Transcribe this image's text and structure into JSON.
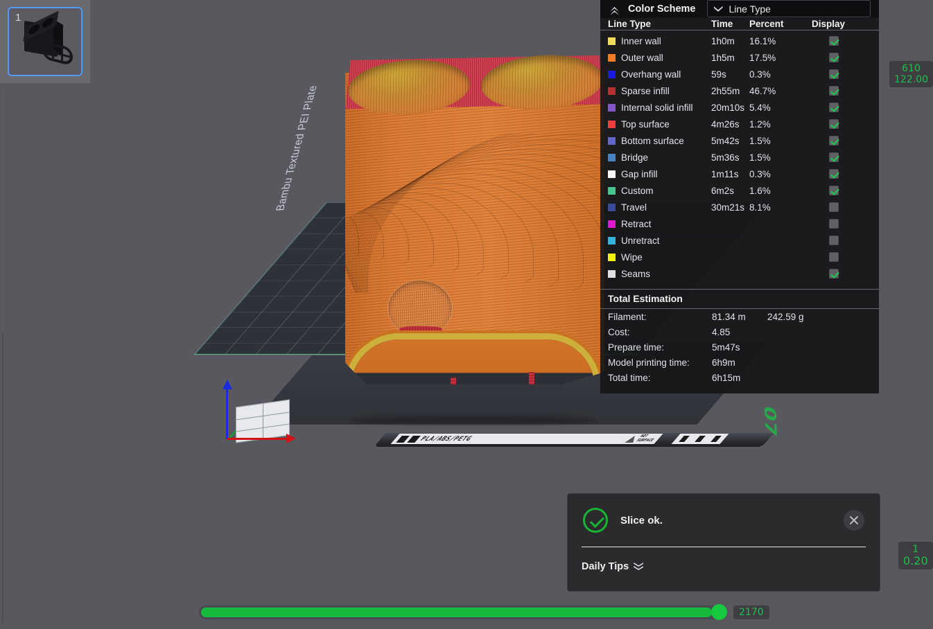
{
  "app": {
    "thumbnail": {
      "plate_number": "1",
      "icon": "plate-thumbnail-icon"
    }
  },
  "viewport": {
    "plate_name": "Bambu Textured PEI Plate",
    "plate_number_marking": "07",
    "bed_material_label": "PLA/ABS/PETG",
    "bed_warning_line1": "HOT",
    "bed_warning_line2": "SURFACE",
    "axis_gizmo": "axis-gizmo"
  },
  "legend": {
    "title": "Color Scheme",
    "collapse_icon": "chevron-up-icon",
    "scheme_select": {
      "value": "Line Type",
      "icon": "chevron-down-icon"
    },
    "columns": {
      "name": "Line Type",
      "time": "Time",
      "percent": "Percent",
      "display": "Display"
    },
    "rows": [
      {
        "color": "#f2dc5a",
        "name": "Inner wall",
        "time": "1h0m",
        "percent": "16.1%",
        "display": true
      },
      {
        "color": "#f07c28",
        "name": "Outer wall",
        "time": "1h5m",
        "percent": "17.5%",
        "display": true
      },
      {
        "color": "#1a1ae8",
        "name": "Overhang wall",
        "time": "59s",
        "percent": "0.3%",
        "display": true
      },
      {
        "color": "#b4332f",
        "name": "Sparse infill",
        "time": "2h55m",
        "percent": "46.7%",
        "display": true
      },
      {
        "color": "#8457c9",
        "name": "Internal solid infill",
        "time": "20m10s",
        "percent": "5.4%",
        "display": true
      },
      {
        "color": "#ef3e3e",
        "name": "Top surface",
        "time": "4m26s",
        "percent": "1.2%",
        "display": true
      },
      {
        "color": "#6267c9",
        "name": "Bottom surface",
        "time": "5m42s",
        "percent": "1.5%",
        "display": true
      },
      {
        "color": "#4783c2",
        "name": "Bridge",
        "time": "5m36s",
        "percent": "1.5%",
        "display": true
      },
      {
        "color": "#f6f6f6",
        "name": "Gap infill",
        "time": "1m11s",
        "percent": "0.3%",
        "display": true
      },
      {
        "color": "#46c68c",
        "name": "Custom",
        "time": "6m2s",
        "percent": "1.6%",
        "display": true
      },
      {
        "color": "#3c4a9e",
        "name": "Travel",
        "time": "30m21s",
        "percent": "8.1%",
        "display": false
      },
      {
        "color": "#e018cf",
        "name": "Retract",
        "time": "",
        "percent": "",
        "display": false
      },
      {
        "color": "#34b3dc",
        "name": "Unretract",
        "time": "",
        "percent": "",
        "display": false
      },
      {
        "color": "#f2f20a",
        "name": "Wipe",
        "time": "",
        "percent": "",
        "display": false
      },
      {
        "color": "#e0e0e0",
        "name": "Seams",
        "time": "",
        "percent": "",
        "display": true
      }
    ],
    "totals": {
      "title": "Total Estimation",
      "rows": [
        {
          "label": "Filament:",
          "value": "81.34 m",
          "value2": "242.59 g"
        },
        {
          "label": "Cost:",
          "value": "4.85",
          "value2": ""
        },
        {
          "label": "Prepare time:",
          "value": "5m47s",
          "value2": ""
        },
        {
          "label": "Model printing time:",
          "value": "6h9m",
          "value2": ""
        },
        {
          "label": "Total time:",
          "value": "6h15m",
          "value2": ""
        }
      ]
    }
  },
  "notification": {
    "status_icon": "check-circle-icon",
    "message": "Slice ok.",
    "close_icon": "close-icon",
    "tips_label": "Daily Tips",
    "tips_icon": "chevron-double-down-icon"
  },
  "layer_slider": {
    "top_layer": "610",
    "top_height": "122.00",
    "bottom_layer": "1",
    "bottom_height": "0.20"
  },
  "move_slider": {
    "value": "2170"
  },
  "colors": {
    "accent_green": "#17bb3c",
    "selection_blue": "#4e9bf0",
    "panel_bg": "#161618",
    "viewport_bg": "#58585e"
  }
}
